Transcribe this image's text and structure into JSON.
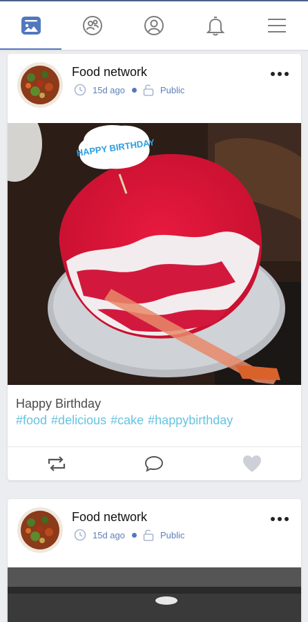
{
  "nav": {
    "items": [
      {
        "icon": "photo-feed-icon",
        "active": true
      },
      {
        "icon": "users-group-icon",
        "active": false
      },
      {
        "icon": "profile-icon",
        "active": false
      },
      {
        "icon": "bell-icon",
        "active": false
      },
      {
        "icon": "hamburger-menu-icon",
        "active": false
      }
    ],
    "active_color": "#5278bd",
    "inactive_color": "#8a8a8a"
  },
  "posts": [
    {
      "author": "Food network",
      "time": "15d ago",
      "privacy": "Public",
      "caption": "Happy Birthday",
      "hashtags": [
        "#food",
        "#delicious",
        "#cake",
        "#happybirthday"
      ],
      "image_topper_text": "HAPPY BIRTHDAY",
      "actions": [
        "repost-icon",
        "comment-icon",
        "like-heart-icon"
      ]
    },
    {
      "author": "Food network",
      "time": "15d ago",
      "privacy": "Public"
    }
  ],
  "colors": {
    "accent": "#5278bd",
    "meta_text": "#5d7fb8",
    "hashtag": "#66c3e0",
    "background": "#ecedf0"
  }
}
